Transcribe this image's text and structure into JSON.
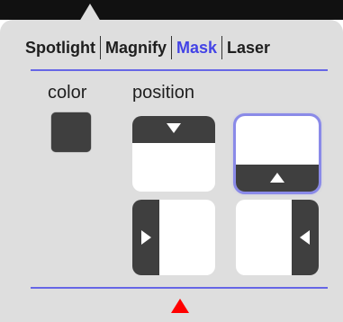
{
  "tabs": [
    {
      "label": "Spotlight",
      "active": false
    },
    {
      "label": "Magnify",
      "active": false
    },
    {
      "label": "Mask",
      "active": true
    },
    {
      "label": "Laser",
      "active": false
    }
  ],
  "labels": {
    "color": "color",
    "position": "position"
  },
  "colors": {
    "accent": "#4343e6",
    "mask_color": "#3f3f3f",
    "popover_bg": "#dedede",
    "divider": "#6666e6",
    "indicator": "#ff0000"
  },
  "positions": [
    {
      "id": "top",
      "icon": "mask-top-icon",
      "selected": false
    },
    {
      "id": "bottom",
      "icon": "mask-bottom-icon",
      "selected": true
    },
    {
      "id": "left",
      "icon": "mask-left-icon",
      "selected": false
    },
    {
      "id": "right",
      "icon": "mask-right-icon",
      "selected": false
    }
  ]
}
